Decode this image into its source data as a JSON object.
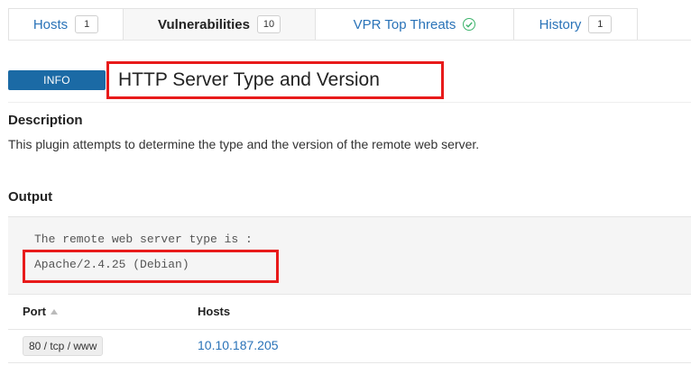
{
  "tabs": [
    {
      "label": "Hosts",
      "count": "1"
    },
    {
      "label": "Vulnerabilities",
      "count": "10"
    },
    {
      "label": "VPR Top Threats",
      "icon": "check-circle-icon"
    },
    {
      "label": "History",
      "count": "1"
    }
  ],
  "plugin": {
    "severity": "INFO",
    "severity_color": "#1b6aa5",
    "title": "HTTP Server Type and Version"
  },
  "description": {
    "heading": "Description",
    "text": "This plugin attempts to determine the type and the version of the remote web server."
  },
  "output": {
    "heading": "Output",
    "line1": "The remote web server type is :",
    "line2": "Apache/2.4.25 (Debian)"
  },
  "table": {
    "headers": {
      "port": "Port",
      "hosts": "Hosts"
    },
    "rows": [
      {
        "port": "80 / tcp / www",
        "host": "10.10.187.205"
      }
    ]
  },
  "colors": {
    "link": "#2a73b8",
    "highlight": "#e81a1a",
    "success": "#3cb36b"
  }
}
